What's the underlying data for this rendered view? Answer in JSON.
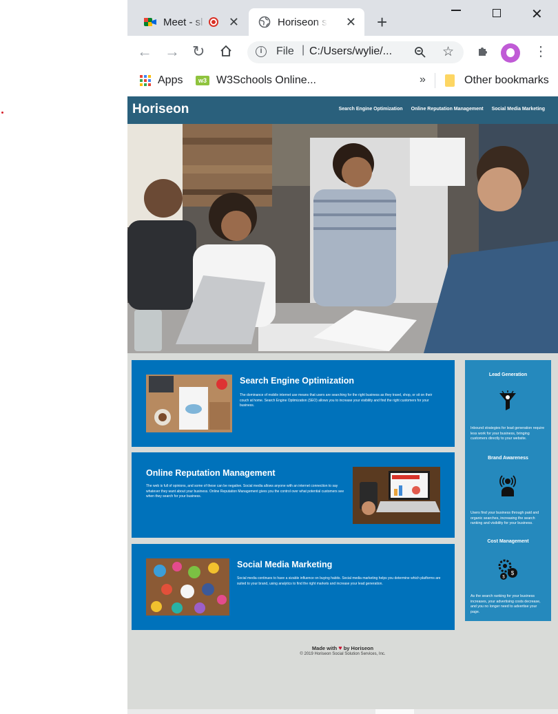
{
  "browser": {
    "tabs": [
      {
        "title": "Meet - sl",
        "active": false
      },
      {
        "title": "Horiseon sea",
        "active": true
      }
    ],
    "address": {
      "scheme": "File",
      "url": "C:/Users/wylie/..."
    },
    "bookmarks": [
      {
        "label": "Apps"
      },
      {
        "label": "W3Schools Online..."
      }
    ],
    "other_bookmarks": "Other bookmarks",
    "overflow": "»"
  },
  "site": {
    "logo": "Horiseon",
    "nav": [
      "Search Engine Optimization",
      "Online Reputation Management",
      "Social Media Marketing"
    ],
    "cards": [
      {
        "title": "Search Engine Optimization",
        "text": "The dominance of mobile internet use means that users are searching for the right business as they travel, shop, or sit on their couch at home. Search Engine Optimization (SEO) allows you to increase your visibility and find the right customers for your business."
      },
      {
        "title": "Online Reputation Management",
        "text": "The web is full of opinions, and some of these can be negative. Social media allows anyone with an internet connection to say whatever they want about your business. Online Reputation Management gives you the control over what potential customers see when they search for your business."
      },
      {
        "title": "Social Media Marketing",
        "text": "Social media continues to have a sizable influence on buying habits. Social media marketing helps you determine which platforms are suited to your brand, using analytics to find the right markets and increase your lead generation."
      }
    ],
    "benefits": [
      {
        "title": "Lead Generation",
        "text": "Inbound strategies for lead generation require less work for your business, bringing customers directly to your website."
      },
      {
        "title": "Brand Awareness",
        "text": "Users find your business through paid and organic searches, increasing the search ranking and visibility for your business."
      },
      {
        "title": "Cost Management",
        "text": "As the search ranking for your business increases, your advertising costs decrease, and you no longer need to advertise your page."
      }
    ],
    "footer": {
      "made_prefix": "Made with",
      "made_suffix": "by Horiseon",
      "copyright": "© 2019 Horiseon Social Solution Services, Inc."
    }
  },
  "colors": {
    "header": "#2a607c",
    "card": "#0072bb",
    "benefits": "#2589bd",
    "page_bg": "#d9dbd8"
  }
}
